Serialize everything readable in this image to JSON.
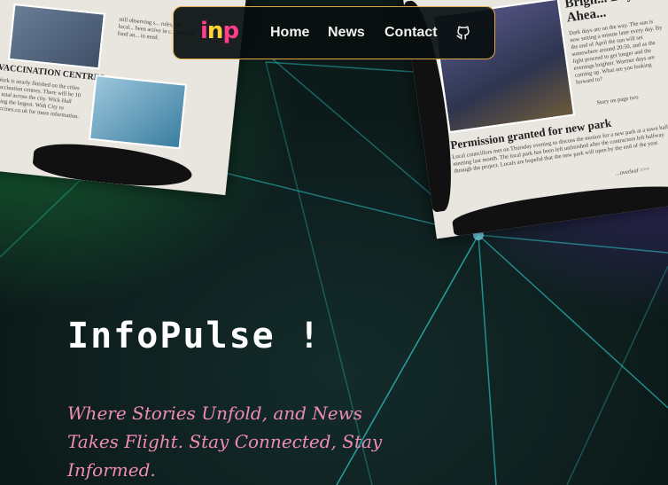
{
  "nav": {
    "logo": "inp",
    "links": [
      "Home",
      "News",
      "Contact"
    ],
    "github_icon": "github-icon"
  },
  "hero": {
    "title": "InfoPulse !",
    "tagline": "Where Stories Unfold, and News Takes Flight. Stay Connected, Stay Informed."
  },
  "newspaper_left": {
    "heading": "VACCINATION CENTRES",
    "snippet_top": "still observing s... rules, the local... been active in c... provide food an... in need.",
    "snippet_body": "Work is nearly finished on the cities vaccination centres. There will be 10 in total across the city. Wick Hall being the largest. With City to vaccines.co.uk for more information."
  },
  "newspaper_right": {
    "heading_top": "Brigh... Days Ahea...",
    "snippet_top": "Dark days are on the way. The sun is now setting a minute later every day. By the end of April the sun will set somewhere around 20:50, and as the light proceed to get longer and the evenings brighter. Warmer days are coming up. What are you looking forward to?",
    "story_note": "Story on page two",
    "heading_main": "Permission granted for new park",
    "snippet_main": "Local councillors met on Thursday evening to discuss the motion for a new park at a town hall meeting last month. The local park has been left unfinished after the contractors left halfway through the project. Locals are hopeful that the new park will open by the end of the year.",
    "overleaf": "...overleaf >>>"
  },
  "colors": {
    "nav_border": "#e0a64a",
    "tagline": "#f08cb4",
    "logo_pink": "#ff3d8b",
    "logo_yellow": "#ffd23a"
  }
}
